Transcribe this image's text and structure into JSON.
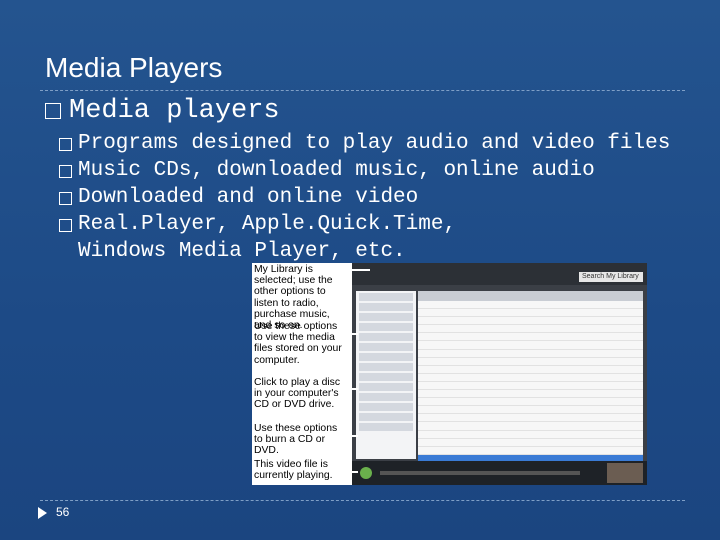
{
  "slide": {
    "title": "Media Players",
    "bullet": "Media players",
    "sub_bullets": [
      "Programs designed to play audio and video files",
      "Music CDs, downloaded music, online audio",
      "Downloaded and online video",
      "Real.Player, Apple.Quick.Time, Windows Media Player, etc."
    ],
    "page_number": "56"
  },
  "screenshot": {
    "callouts": [
      "My Library is selected; use the other options to listen to radio, purchase music, and so on.",
      "Use these options to view the media files stored on your computer.",
      "Click to play a disc in your computer's CD or DVD drive.",
      "Use these options to burn a CD or DVD.",
      "This video file is currently playing."
    ],
    "search_placeholder": "Search My Library"
  },
  "colors": {
    "background": "#1f4e8c",
    "text": "#ffffff",
    "rule": "#7f9fc6"
  }
}
